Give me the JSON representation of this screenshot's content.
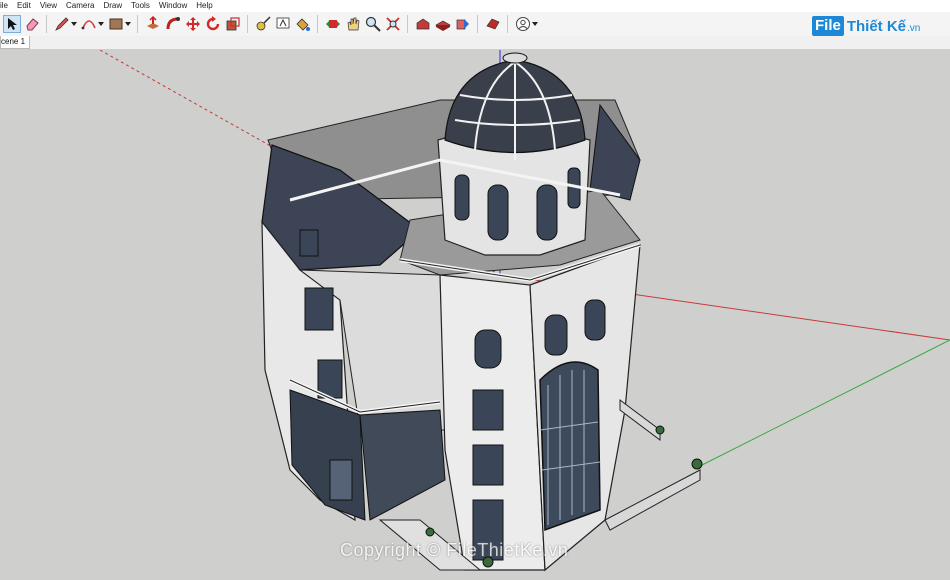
{
  "menu": [
    "ile",
    "Edit",
    "View",
    "Camera",
    "Draw",
    "Tools",
    "Window",
    "Help"
  ],
  "scene_tab": "cene 1",
  "logo": {
    "box": "File",
    "name": "Thiết Kế",
    "tld": ".vn"
  },
  "watermark": "Copyright © FileThietKe.vn",
  "colors": {
    "viewport": "#cfcfcd",
    "accent": "#1c88d6",
    "red_axis": "#c63a3a",
    "green_axis": "#3aa63a",
    "blue_axis": "#2a2ad6"
  }
}
